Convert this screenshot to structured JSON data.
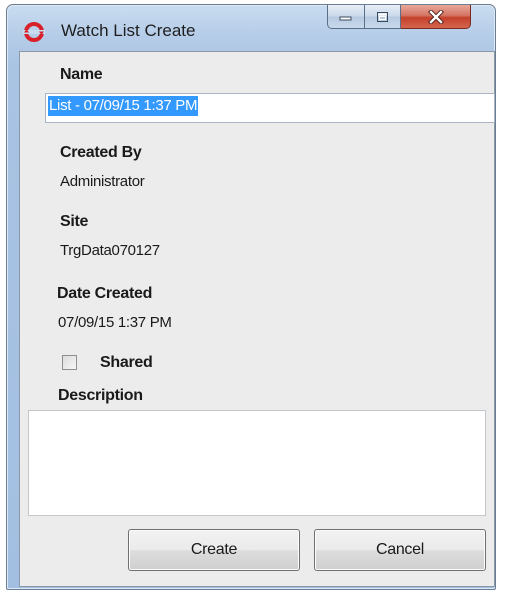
{
  "window": {
    "title": "Watch List Create"
  },
  "form": {
    "name_label": "Name",
    "name_value": "List - 07/09/15 1:37 PM",
    "created_by_label": "Created By",
    "created_by_value": "Administrator",
    "site_label": "Site",
    "site_value": "TrgData070127",
    "date_created_label": "Date Created",
    "date_created_value": "07/09/15 1:37 PM",
    "shared_label": "Shared",
    "shared_checked": false,
    "description_label": "Description",
    "description_value": ""
  },
  "buttons": {
    "create_label": "Create",
    "cancel_label": "Cancel"
  },
  "icons": {
    "app": "app-logo-icon",
    "minimize": "minimize-icon",
    "maximize": "maximize-icon",
    "close": "close-icon"
  },
  "colors": {
    "selection": "#3399ff",
    "close_button": "#c4412c",
    "app_icon": "#d8202a"
  }
}
